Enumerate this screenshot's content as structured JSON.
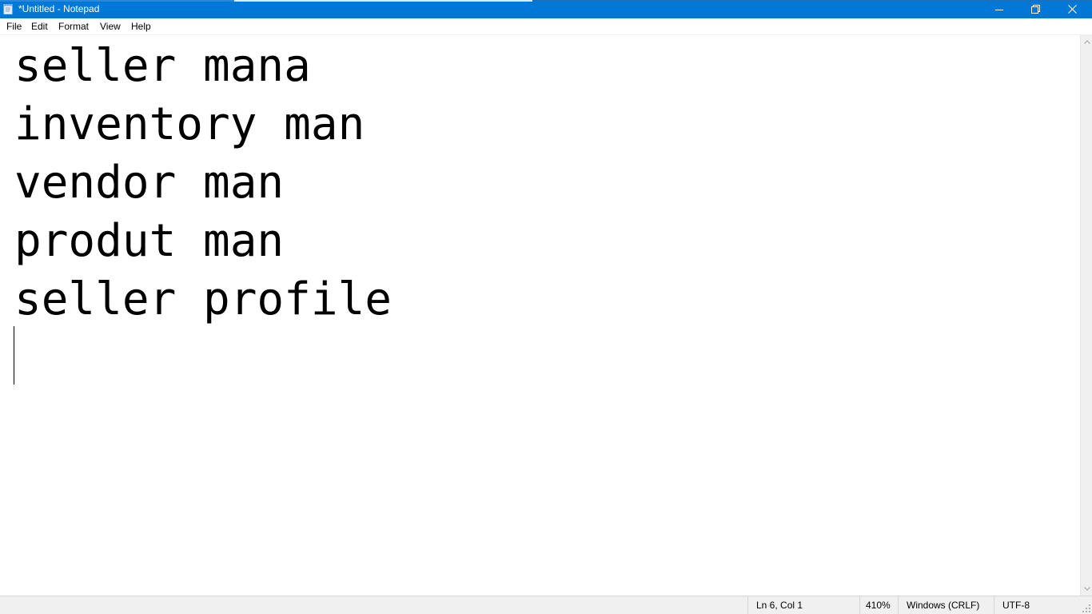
{
  "window": {
    "title": "*Untitled - Notepad",
    "accent_color": "#0078d7",
    "icons": {
      "app": "notepad-icon",
      "minimize": "minimize-icon",
      "restore": "restore-icon",
      "close": "close-icon"
    }
  },
  "menu": {
    "items": [
      {
        "label": "File"
      },
      {
        "label": "Edit"
      },
      {
        "label": "Format"
      },
      {
        "label": "View"
      },
      {
        "label": "Help"
      }
    ]
  },
  "editor": {
    "lines": [
      "seller mana",
      "inventory man",
      "vendor man",
      "produt man",
      "seller profile",
      ""
    ]
  },
  "status": {
    "position": "Ln 6, Col 1",
    "zoom": "410%",
    "line_ending": "Windows (CRLF)",
    "encoding": "UTF-8"
  }
}
